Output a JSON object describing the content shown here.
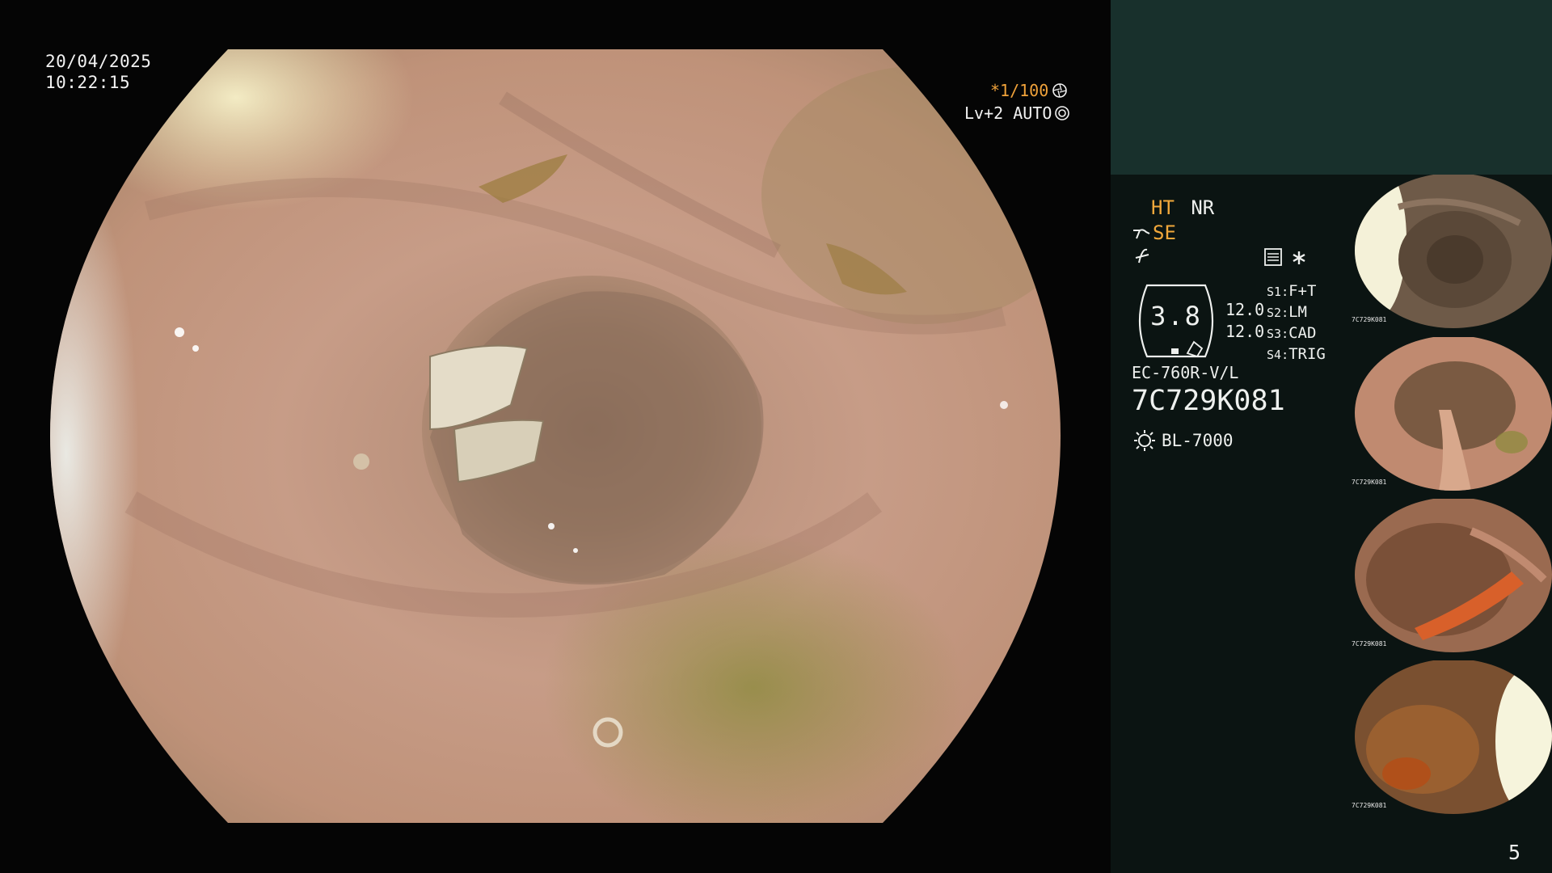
{
  "overlay": {
    "date": "20/04/2025",
    "time": "10:22:15",
    "shutter_speed": "*1/100",
    "level": "Lv+2 AUTO"
  },
  "panel": {
    "ht": "HT",
    "nr": "NR",
    "se": "SE",
    "gauge_value": "3.8",
    "gauge_sub1": "12.0",
    "gauge_sub2": "12.0",
    "modes": [
      {
        "key": "S1",
        "value": "F+T"
      },
      {
        "key": "S2",
        "value": "LM"
      },
      {
        "key": "S3",
        "value": "CAD"
      },
      {
        "key": "S4",
        "value": "TRIG"
      }
    ],
    "scope_model": "EC-760R-V/L",
    "serial": "7C729K081",
    "light_source": "BL-7000",
    "page_number": "5"
  },
  "thumbnails": [
    {
      "serial": "7C729K081"
    },
    {
      "serial": "7C729K081"
    },
    {
      "serial": "7C729K081"
    },
    {
      "serial": "7C729K081"
    }
  ],
  "colors": {
    "accent_amber": "#f2a83b",
    "panel_bg": "#0b1412",
    "panel_header": "#18302c"
  }
}
